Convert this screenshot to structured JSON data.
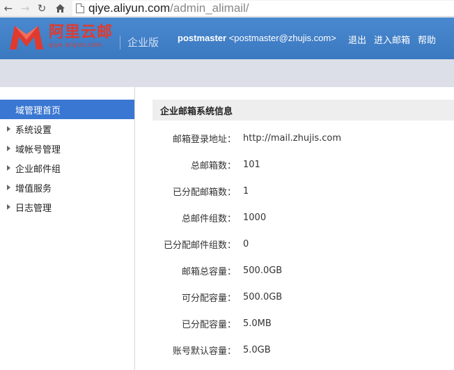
{
  "browser": {
    "url_host": "qiye.aliyun.com",
    "url_path": "/admin_alimail/",
    "icons": [
      "back-icon",
      "forward-icon",
      "reload-icon",
      "home-icon",
      "page-icon"
    ]
  },
  "header": {
    "logo_text": "阿里云邮",
    "logo_url": "qiye.aliyun.com",
    "edition": "企业版",
    "user_name": "postmaster",
    "user_email": "<postmaster@zhujis.com>",
    "links": [
      "退出",
      "进入邮箱",
      "帮助"
    ],
    "colors": {
      "header_bg": "#3f7fc8",
      "brand_red": "#e03a2e",
      "active_nav": "#3a77d2"
    }
  },
  "sidebar": {
    "items": [
      {
        "label": "域管理首页",
        "active": true
      },
      {
        "label": "系统设置",
        "active": false
      },
      {
        "label": "域帐号管理",
        "active": false
      },
      {
        "label": "企业邮件组",
        "active": false
      },
      {
        "label": "增值服务",
        "active": false
      },
      {
        "label": "日志管理",
        "active": false
      }
    ]
  },
  "main": {
    "section_title": "企业邮箱系统信息",
    "rows": [
      {
        "label": "邮箱登录地址：",
        "value": "http://mail.zhujis.com"
      },
      {
        "label": "总邮箱数：",
        "value": "101"
      },
      {
        "label": "已分配邮箱数：",
        "value": "1"
      },
      {
        "label": "总邮件组数：",
        "value": "1000"
      },
      {
        "label": "已分配邮件组数：",
        "value": "0"
      },
      {
        "label": "邮箱总容量：",
        "value": "500.0GB"
      },
      {
        "label": "可分配容量：",
        "value": "500.0GB"
      },
      {
        "label": "已分配容量：",
        "value": "5.0MB"
      },
      {
        "label": "账号默认容量：",
        "value": "5.0GB"
      }
    ]
  }
}
